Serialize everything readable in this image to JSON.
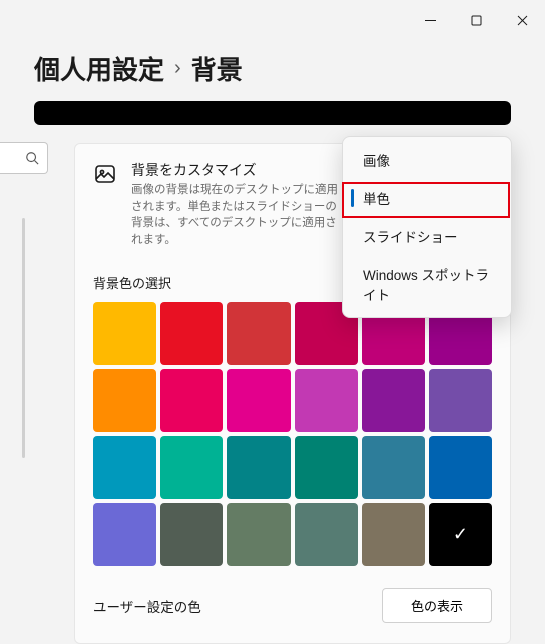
{
  "titlebar": {
    "min_name": "minimize-icon",
    "max_name": "maximize-icon",
    "close_name": "close-icon"
  },
  "breadcrumb": {
    "parent": "個人用設定",
    "separator": "›",
    "current": "背景"
  },
  "search": {
    "placeholder": ""
  },
  "customize": {
    "icon_name": "picture-icon",
    "title": "背景をカスタマイズ",
    "description": "画像の背景は現在のデスクトップに適用されます。単色またはスライドショーの背景は、すべてのデスクトップに適用されます。"
  },
  "dropdown": {
    "items": [
      {
        "label": "画像",
        "selected": false
      },
      {
        "label": "単色",
        "selected": true
      },
      {
        "label": "スライドショー",
        "selected": false
      },
      {
        "label": "Windows スポットライト",
        "selected": false
      }
    ]
  },
  "color_section": {
    "label": "背景色の選択"
  },
  "colors": [
    "#ffb900",
    "#e81123",
    "#d13438",
    "#c30052",
    "#bf0077",
    "#9a0089",
    "#ff8c00",
    "#ea005e",
    "#e3008c",
    "#c239b3",
    "#881798",
    "#744da9",
    "#0099bc",
    "#00b294",
    "#038387",
    "#008272",
    "#2d7d9a",
    "#0063b1",
    "#6b69d6",
    "#525e54",
    "#647c64",
    "#567c73",
    "#7e735f",
    "#000000"
  ],
  "selected_color_index": 23,
  "footer": {
    "label": "ユーザー設定の色",
    "button": "色の表示"
  }
}
